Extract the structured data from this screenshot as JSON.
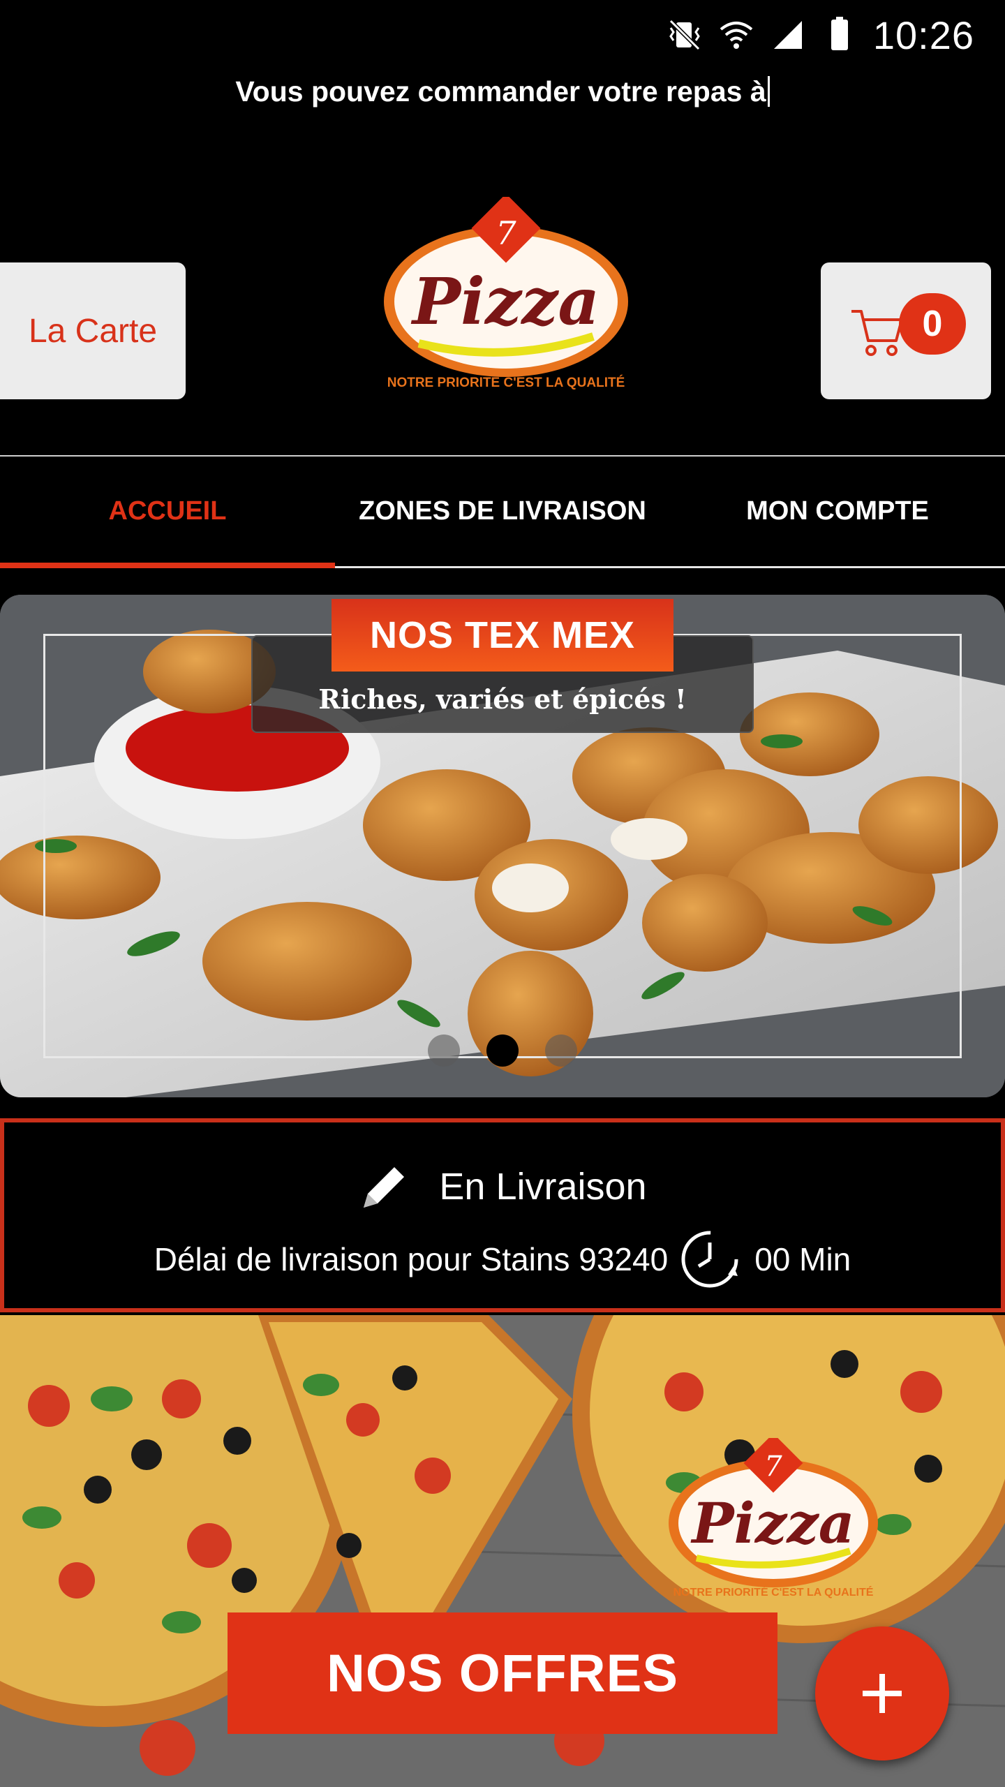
{
  "status_bar": {
    "time": "10:26",
    "icons": [
      "vibrate-mute-icon",
      "wifi-icon",
      "signal-icon",
      "battery-icon"
    ]
  },
  "ticker": {
    "text": "Vous pouvez commander votre repas à"
  },
  "header": {
    "menu_button_label": "La Carte",
    "cart_count": "0",
    "logo": {
      "number": "7",
      "name": "Pizza",
      "tagline": "NOTRE PRIORITÉ C'EST LA QUALITÉ"
    }
  },
  "tabs": [
    {
      "label": "ACCUEIL",
      "active": true
    },
    {
      "label": "ZONES DE LIVRAISON",
      "active": false
    },
    {
      "label": "MON COMPTE",
      "active": false
    }
  ],
  "banner": {
    "title": "NOS TEX MEX",
    "subtitle": "Riches, variés et épicés !",
    "slide_count": 3,
    "active_slide": 2
  },
  "delivery": {
    "mode": "En Livraison",
    "delay_text": "Délai de livraison pour Stains 93240",
    "delay_value": "00 Min"
  },
  "promo": {
    "button_label": "NOS OFFRES",
    "fab_icon": "plus-icon"
  },
  "colors": {
    "accent": "#e03216",
    "background": "#000000",
    "button_bg": "#ececec"
  }
}
